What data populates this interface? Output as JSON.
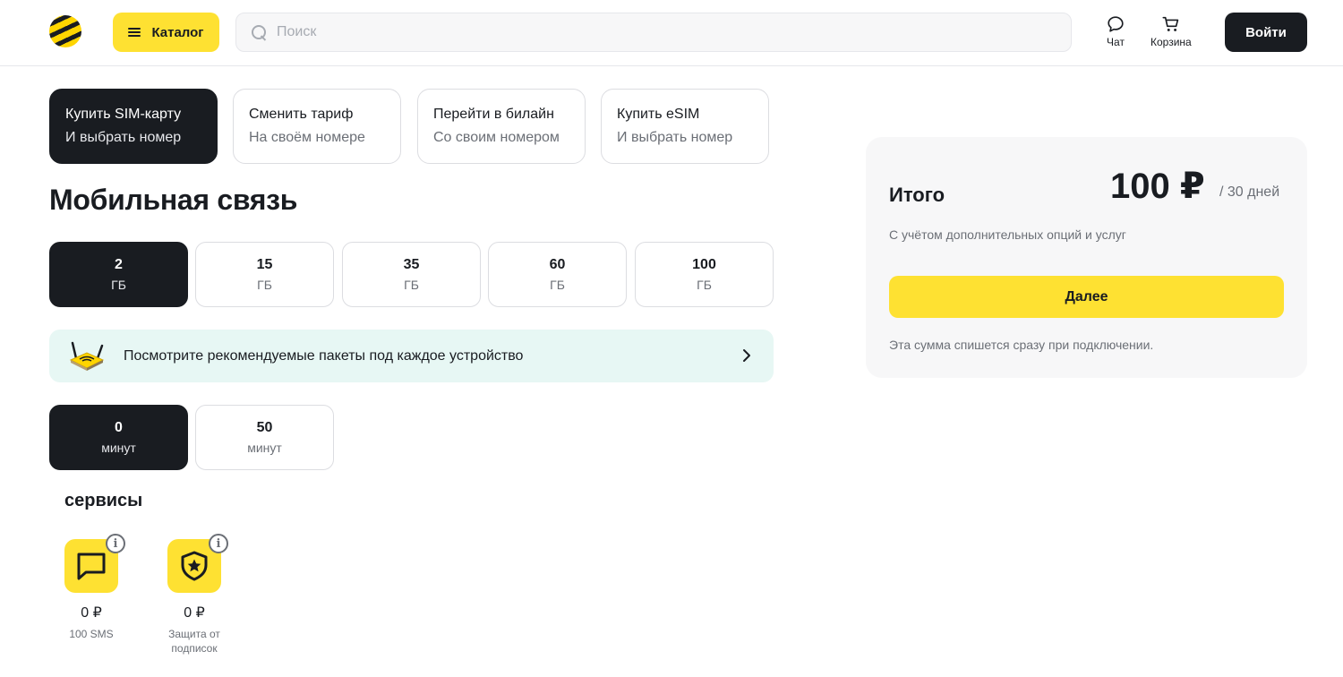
{
  "header": {
    "catalog_label": "Каталог",
    "search_placeholder": "Поиск",
    "chat_label": "Чат",
    "cart_label": "Корзина",
    "login_label": "Войти"
  },
  "scenarios": [
    {
      "title": "Купить SIM-карту",
      "subtitle": "И выбрать номер",
      "active": true
    },
    {
      "title": "Сменить тариф",
      "subtitle": "На своём номере",
      "active": false
    },
    {
      "title": "Перейти в билайн",
      "subtitle": "Со своим номером",
      "active": false
    },
    {
      "title": "Купить eSIM",
      "subtitle": "И выбрать номер",
      "active": false
    }
  ],
  "page_title": "Мобильная связь",
  "internet_options": [
    {
      "value": "2",
      "unit": "ГБ",
      "selected": true
    },
    {
      "value": "15",
      "unit": "ГБ",
      "selected": false
    },
    {
      "value": "35",
      "unit": "ГБ",
      "selected": false
    },
    {
      "value": "60",
      "unit": "ГБ",
      "selected": false
    },
    {
      "value": "100",
      "unit": "ГБ",
      "selected": false
    }
  ],
  "banner": {
    "text": "Посмотрите рекомендуемые пакеты под каждое устройство",
    "icon": "router-icon"
  },
  "minutes_options": [
    {
      "value": "0",
      "unit": "минут",
      "selected": true
    },
    {
      "value": "50",
      "unit": "минут",
      "selected": false
    }
  ],
  "services_title": "сервисы",
  "services": [
    {
      "price": "0 ₽",
      "name": "100 SMS",
      "icon": "message-icon"
    },
    {
      "price": "0 ₽",
      "name": "Защита от подписок",
      "icon": "shield-star-icon"
    }
  ],
  "summary": {
    "title": "Итого",
    "price": "100 ₽",
    "period": "/ 30 дней",
    "note": "С учётом дополнительных опций и услуг",
    "next_label": "Далее",
    "footnote": "Эта сумма спишется сразу при подключении."
  },
  "colors": {
    "brand_yellow": "#fee132",
    "dark": "#191c21",
    "banner_bg": "#e7f7f4",
    "card_bg": "#f7f7f8"
  }
}
